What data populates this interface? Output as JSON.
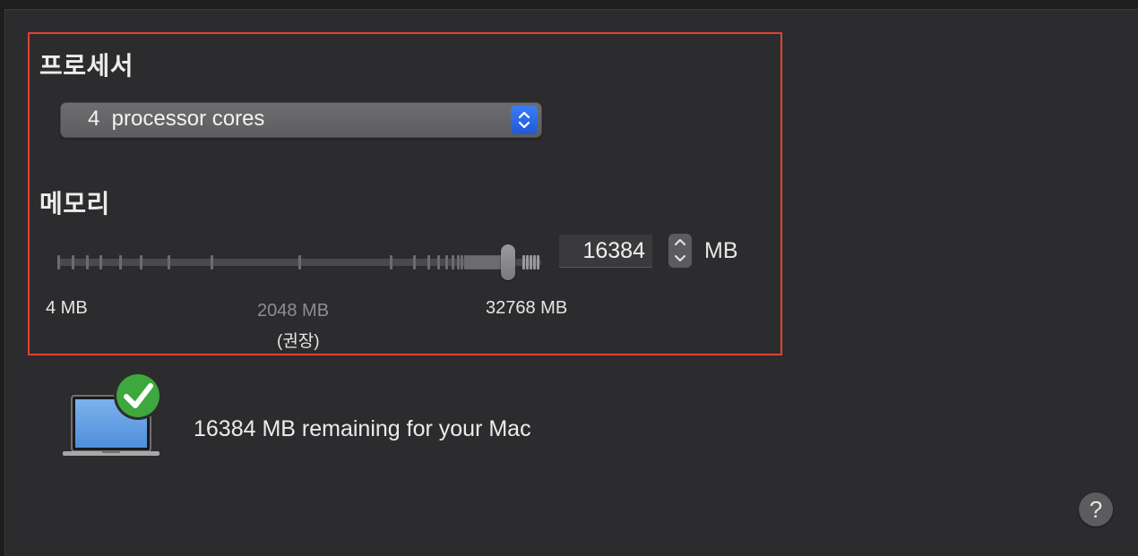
{
  "processor": {
    "title": "프로세서",
    "selected": "4  processor cores"
  },
  "memory": {
    "title": "메모리",
    "min_label": "4 MB",
    "recommended_value_label": "2048 MB",
    "recommended_note": "(권장)",
    "max_label": "32768 MB",
    "value": "16384",
    "unit": "MB"
  },
  "status": {
    "message": "16384 MB remaining for your Mac",
    "icon": "laptop-checkmark-icon"
  },
  "help": {
    "label": "?"
  },
  "colors": {
    "background": "#2c2c2e",
    "highlight_border": "#e0432f",
    "accent": "#2f6ee8",
    "check_green": "#3ea73d"
  }
}
